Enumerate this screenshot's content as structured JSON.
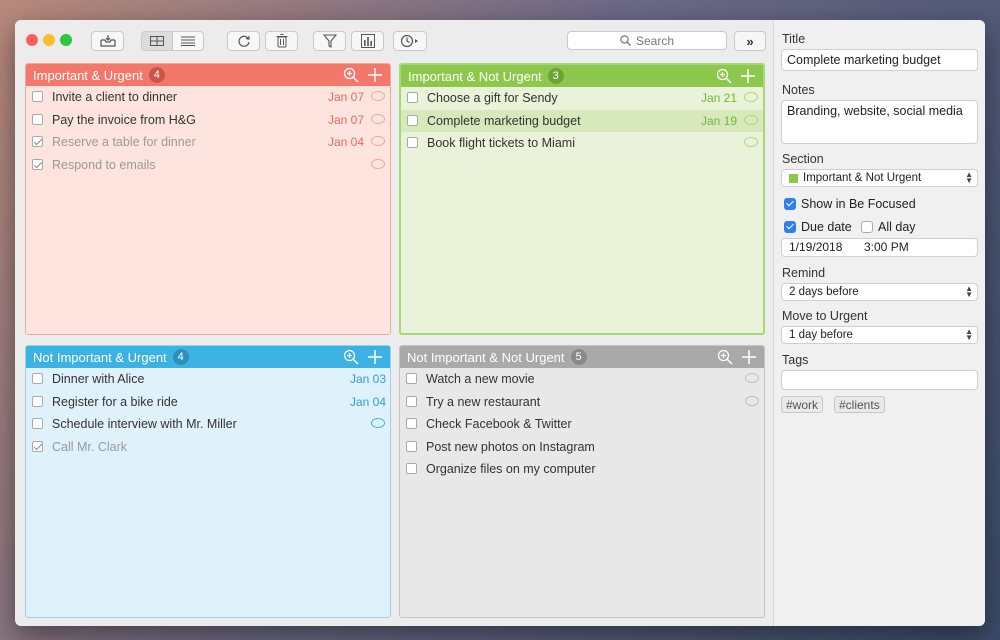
{
  "toolbar": {
    "search_placeholder": "Search",
    "icons": [
      "inbox-icon",
      "grid-view-icon",
      "list-view-icon",
      "refresh-icon",
      "trash-icon",
      "filter-icon",
      "chart-icon",
      "timer-icon",
      "expand-icon"
    ]
  },
  "quadrants": {
    "q1": {
      "title": "Important & Urgent",
      "count": "4",
      "color": "#f4786a",
      "items": [
        {
          "text": "Invite a client to dinner",
          "date": "Jan 07"
        },
        {
          "text": "Pay the invoice from H&G",
          "date": "Jan 07"
        },
        {
          "text": "Reserve a table for dinner",
          "date": "Jan 04"
        },
        {
          "text": "Respond to emails",
          "date": ""
        }
      ]
    },
    "q2": {
      "title": "Important & Not Urgent",
      "count": "3",
      "color": "#8cc84b",
      "items": [
        {
          "text": "Choose a gift for Sendy",
          "date": "Jan 21"
        },
        {
          "text": "Complete marketing budget",
          "date": "Jan 19"
        },
        {
          "text": "Book flight tickets to Miami",
          "date": ""
        }
      ]
    },
    "q3": {
      "title": "Not Important & Urgent",
      "count": "4",
      "color": "#3cb2e2",
      "items": [
        {
          "text": "Dinner with Alice",
          "date": "Jan 03"
        },
        {
          "text": "Register for a bike ride",
          "date": "Jan 04"
        },
        {
          "text": "Schedule interview with Mr. Miller",
          "date": ""
        },
        {
          "text": "Call Mr. Clark",
          "date": ""
        }
      ]
    },
    "q4": {
      "title": "Not Important & Not Urgent",
      "count": "5",
      "color": "#a9a9a9",
      "items": [
        {
          "text": "Watch a new movie",
          "date": ""
        },
        {
          "text": "Try a new restaurant",
          "date": ""
        },
        {
          "text": "Check Facebook & Twitter",
          "date": ""
        },
        {
          "text": "Post new photos on Instagram",
          "date": ""
        },
        {
          "text": "Organize files on my computer",
          "date": ""
        }
      ]
    }
  },
  "details": {
    "title_label": "Title",
    "title_value": "Complete marketing budget",
    "notes_label": "Notes",
    "notes_value": "Branding, website, social media",
    "section_label": "Section",
    "section_value": "Important & Not Urgent",
    "show_focused_label": "Show in Be Focused",
    "due_date_label": "Due date",
    "all_day_label": "All day",
    "date_value": "1/19/2018",
    "time_value": "3:00 PM",
    "remind_label": "Remind",
    "remind_value": "2 days before",
    "move_label": "Move to Urgent",
    "move_value": "1 day before",
    "tags_label": "Tags",
    "tags": [
      "#work",
      "#clients"
    ]
  }
}
